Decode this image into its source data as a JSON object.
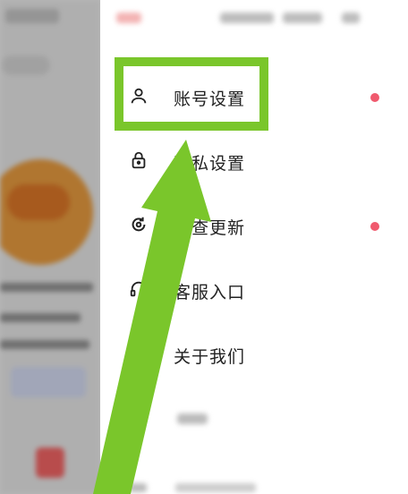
{
  "drawer": {
    "items": [
      {
        "label": "账号设置",
        "icon": "user-icon",
        "badge_dot": true
      },
      {
        "label": "隐私设置",
        "icon": "lock-icon",
        "badge_dot": false
      },
      {
        "label": "检查更新",
        "icon": "refresh-icon",
        "badge_dot": true
      },
      {
        "label": "客服入口",
        "icon": "headset-icon",
        "badge_dot": false
      },
      {
        "label": "关于我们",
        "icon": "",
        "badge_dot": false
      },
      {
        "label": "",
        "icon": "sliders-icon",
        "badge_dot": false
      }
    ]
  },
  "colors": {
    "highlight": "#7ac62b",
    "badge_dot": "#f05a6e",
    "text": "#222222"
  }
}
